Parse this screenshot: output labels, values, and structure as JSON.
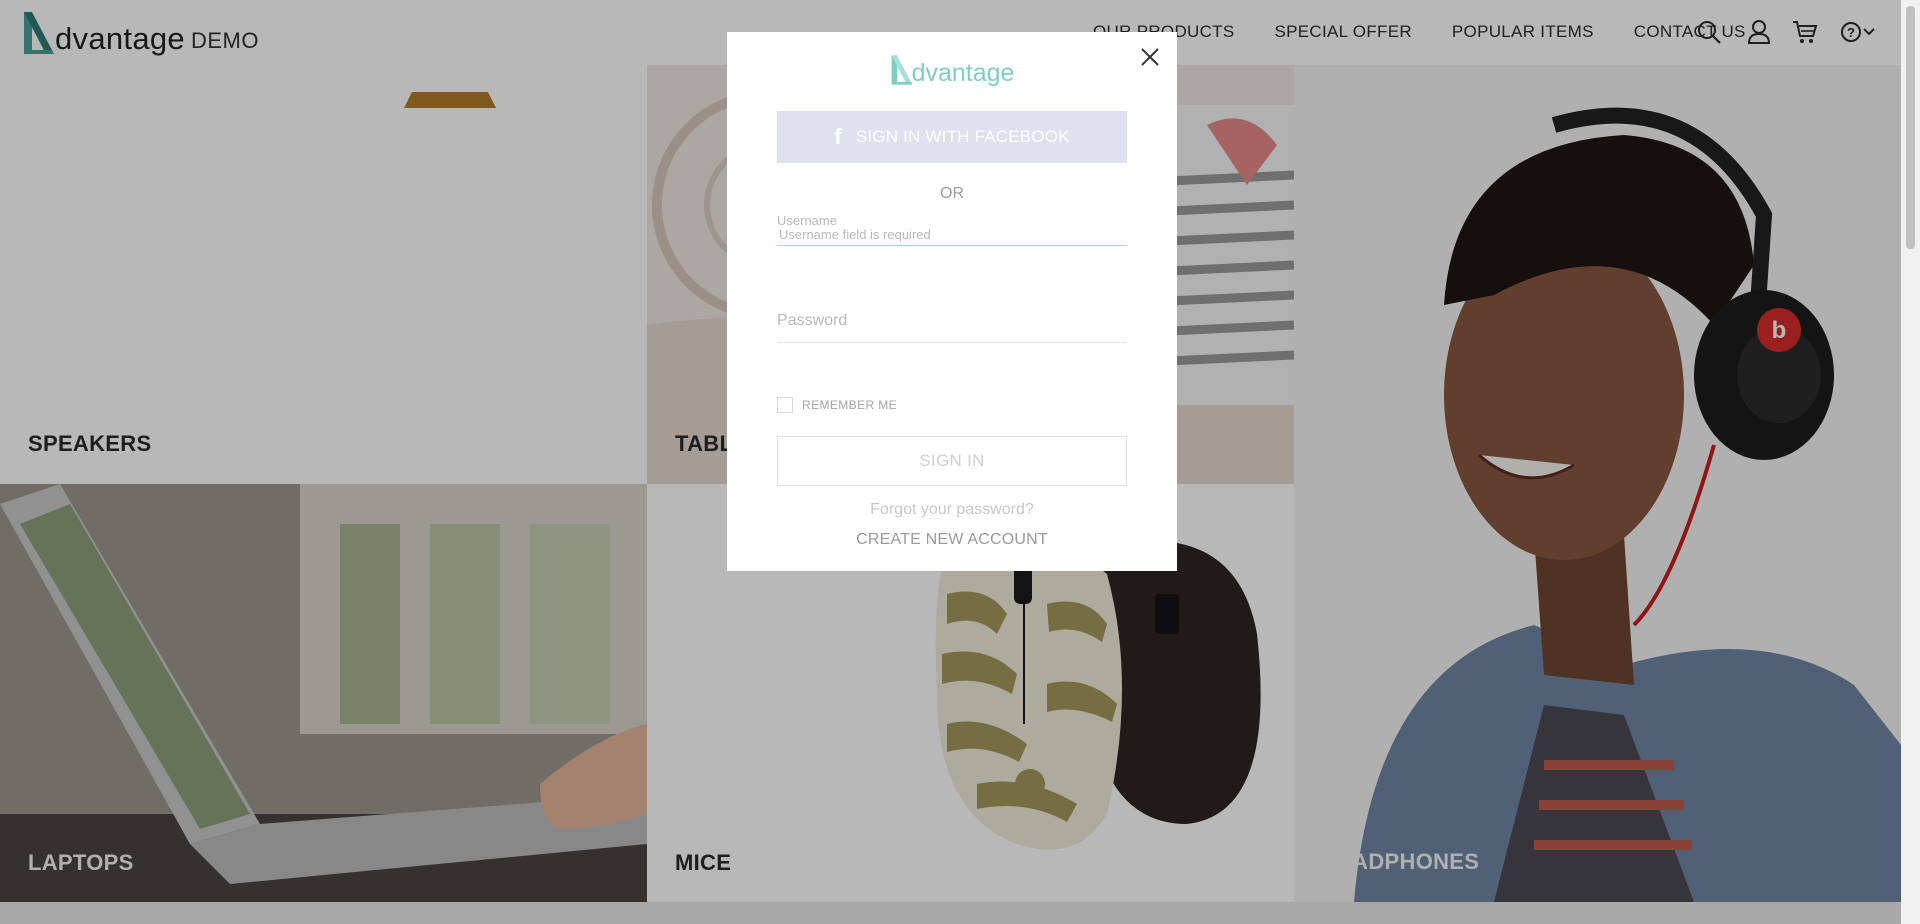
{
  "header": {
    "logo_word": "dvantage",
    "logo_suffix": "DEMO",
    "nav": [
      {
        "label": "OUR PRODUCTS"
      },
      {
        "label": "SPECIAL OFFER"
      },
      {
        "label": "POPULAR ITEMS"
      },
      {
        "label": "CONTACT US"
      }
    ],
    "icons": [
      "search-icon",
      "user-icon",
      "cart-icon",
      "help-icon",
      "chevron-down-icon"
    ]
  },
  "categories": [
    {
      "label": "SPEAKERS"
    },
    {
      "label": "TABLETS"
    },
    {
      "label": "HEADPHONES"
    },
    {
      "label": "LAPTOPS"
    },
    {
      "label": "MICE"
    }
  ],
  "login_modal": {
    "logo_word": "dvantage",
    "facebook_button": "SIGN IN WITH FACEBOOK",
    "or_text": "OR",
    "username": {
      "label": "Username",
      "value": "",
      "error": "Username field is required"
    },
    "password": {
      "placeholder": "Password",
      "value": ""
    },
    "remember_me": "REMEMBER ME",
    "remember_checked": false,
    "sign_in_button": "SIGN IN",
    "forgot_password": "Forgot your password?",
    "create_account": "CREATE NEW ACCOUNT"
  },
  "colors": {
    "brand_teal": "#4e9e96",
    "modal_logo_teal": "#7ecec6",
    "error_line": "#f0b9b9",
    "facebook_button_bg": "#dde2ee"
  }
}
